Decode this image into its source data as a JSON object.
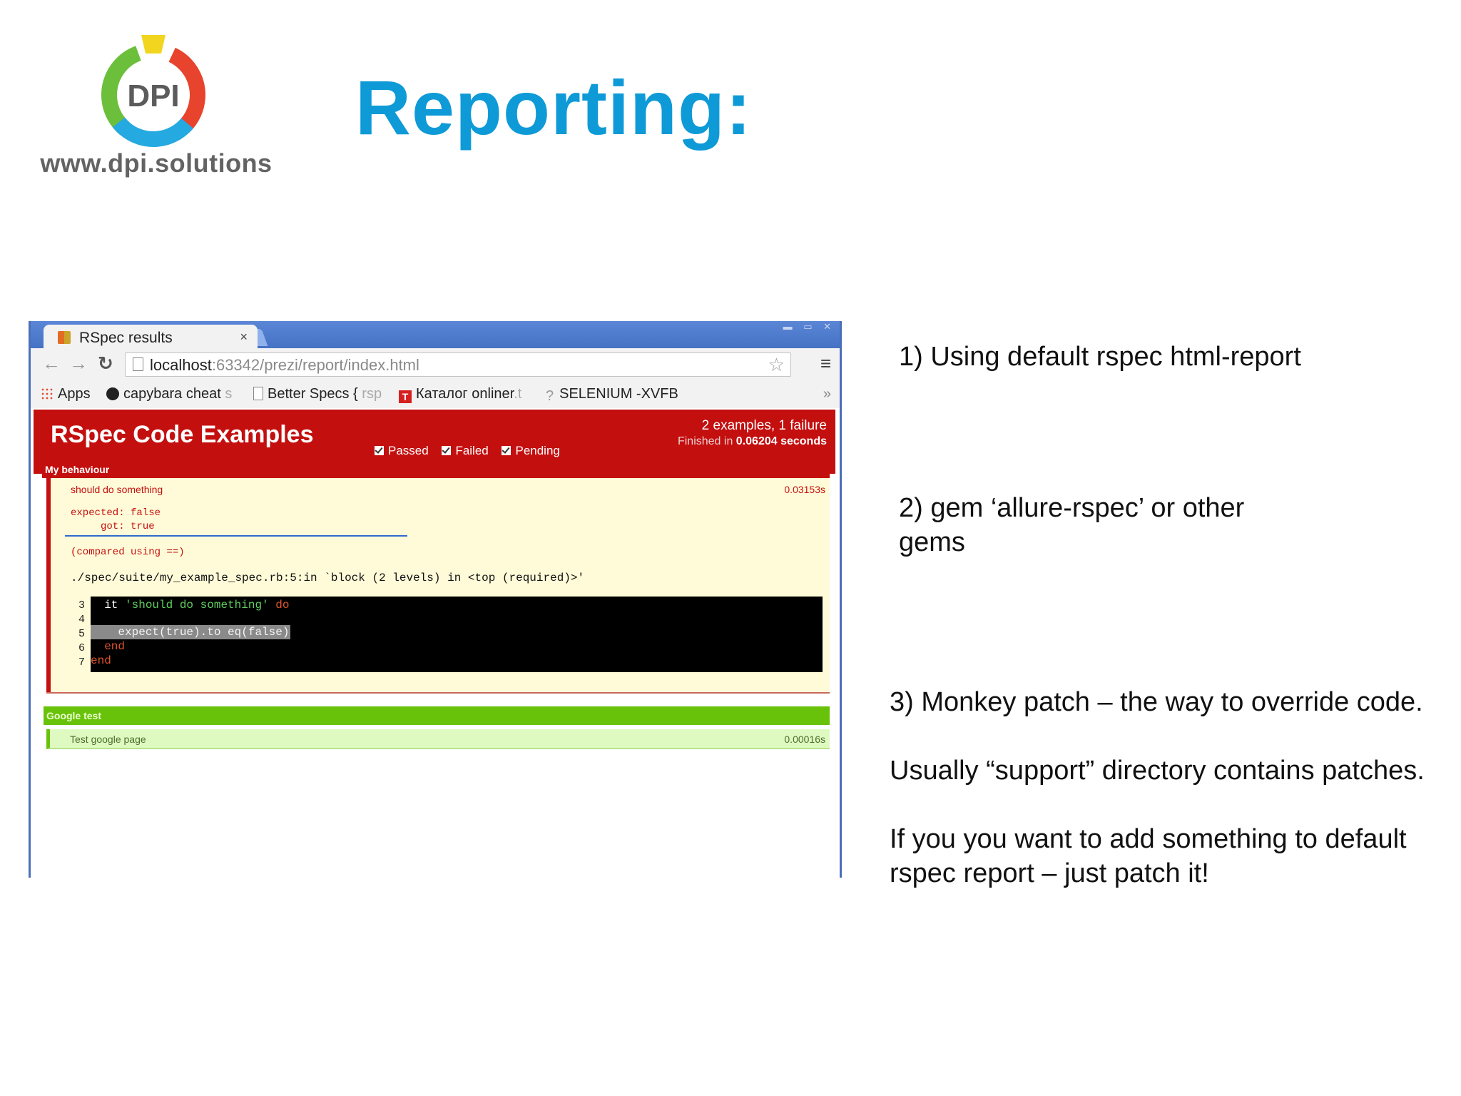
{
  "slide": {
    "logo_text": "DPI",
    "logo_url": "www.dpi.solutions",
    "title": "Reporting:",
    "brand_colors": {
      "title_blue": "#0e9ad7",
      "logo_green": "#6cbf3a",
      "logo_red": "#e8432c",
      "logo_yellow": "#f2d51f",
      "logo_blue": "#24a9e1"
    }
  },
  "notes": [
    "1) Using default rspec html-report",
    "2) gem ‘allure-rspec’ or other gems",
    "3) Monkey patch – the way to override code.",
    "Usually “support” directory contains patches.",
    "If you you want to add something to default rspec report – just patch it!"
  ],
  "browser": {
    "tab": {
      "title": "RSpec results",
      "close": "×",
      "favicon": "rspec-favicon"
    },
    "url": {
      "host": "localhost",
      "rest": ":63342/prezi/report/index.html"
    },
    "icons": {
      "back": "back-arrow-icon",
      "forward": "forward-arrow-icon",
      "reload": "reload-icon",
      "star": "star-icon",
      "menu": "menu-icon"
    },
    "bookmarks": [
      {
        "label": "Apps",
        "tail": "",
        "icon": "apps-grid-icon"
      },
      {
        "label": "capybara cheat",
        "tail": " s",
        "icon": "github-icon"
      },
      {
        "label": "Better Specs { ",
        "tail": "rsp",
        "icon": "page-icon"
      },
      {
        "label": "Каталог onliner",
        "tail": ".t",
        "icon": "onliner-icon"
      },
      {
        "label": "SELENIUM -XVFB",
        "tail": "",
        "icon": "question-icon"
      }
    ],
    "bookmarks_more": "»"
  },
  "report": {
    "title": "RSpec Code Examples",
    "filters": [
      "Passed",
      "Failed",
      "Pending"
    ],
    "summary": "2 examples, 1 failure",
    "finished_prefix": "Finished in ",
    "finished_time": "0.06204 seconds",
    "groups": [
      {
        "name": "My behaviour",
        "status": "failed",
        "example": {
          "name": "should do something",
          "duration": "0.03153s",
          "message": "expected: false\n     got: true",
          "compared": "(compared using ==)",
          "backtrace": "./spec/suite/my_example_spec.rb:5:in `block (2 levels) in <top (required)>'",
          "snippet": {
            "line_numbers": [
              "3",
              "4",
              "5",
              "6",
              "7"
            ],
            "l3_pre": "  it ",
            "l3_str": "'should do something'",
            "l3_kw": " do",
            "l5": "    expect(true).to eq(false)",
            "l6": "  end",
            "l7": "end"
          }
        }
      },
      {
        "name": "Google test",
        "status": "passed",
        "example": {
          "name": "Test google page",
          "duration": "0.00016s"
        }
      }
    ],
    "colors": {
      "failed": "#c40f0f",
      "passed": "#69c20a",
      "failure_bg": "#fffbd8",
      "pass_bg": "#dffac1"
    }
  }
}
